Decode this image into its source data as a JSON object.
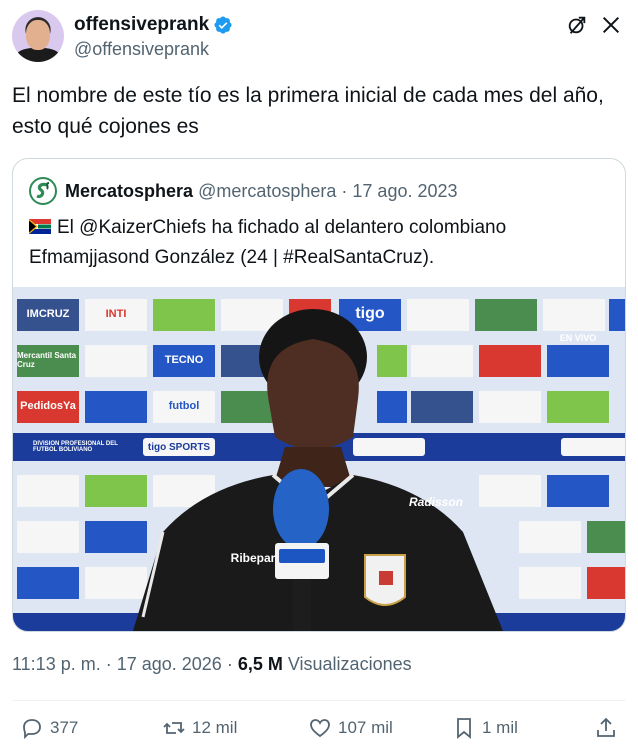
{
  "author": {
    "display_name": "offensiveprank",
    "handle": "@offensiveprank",
    "verified": true
  },
  "tweet": {
    "text": "El nombre de este tío es la primera inicial de cada mes del año, esto qué cojones es"
  },
  "quote": {
    "display_name": "Mercatosphera",
    "handle": "@mercatosphera",
    "separator": "·",
    "date": "17 ago. 2023",
    "flag_icon": "south-africa-flag-icon",
    "text": "El @KaizerChiefs ha fichado al delantero colombiano Efmamjjasond González (24 | #RealSantaCruz).",
    "media": {
      "sponsor_logos": [
        "IMCRUZ",
        "INTI",
        "tigo",
        "TECNO",
        "PedidosYa",
        "Mercantil Santa Cruz",
        "tigo SPORTS",
        "futbol",
        "DIVISION PROFESIONAL DEL FUTBOL BOLIVIANO",
        "Radisson",
        "Ribepar",
        "EN VIVO"
      ]
    }
  },
  "meta": {
    "time": "11:13 p. m.",
    "separator": "·",
    "date": "17 ago. 2026",
    "views_count": "6,5 M",
    "views_label": "Visualizaciones"
  },
  "actions": {
    "replies": "377",
    "reposts": "12 mil",
    "likes": "107 mil",
    "bookmarks": "1 mil"
  },
  "colors": {
    "text_primary": "#0f1419",
    "text_secondary": "#536471",
    "verified_blue": "#1d9bf0",
    "border": "#cfd9de"
  }
}
